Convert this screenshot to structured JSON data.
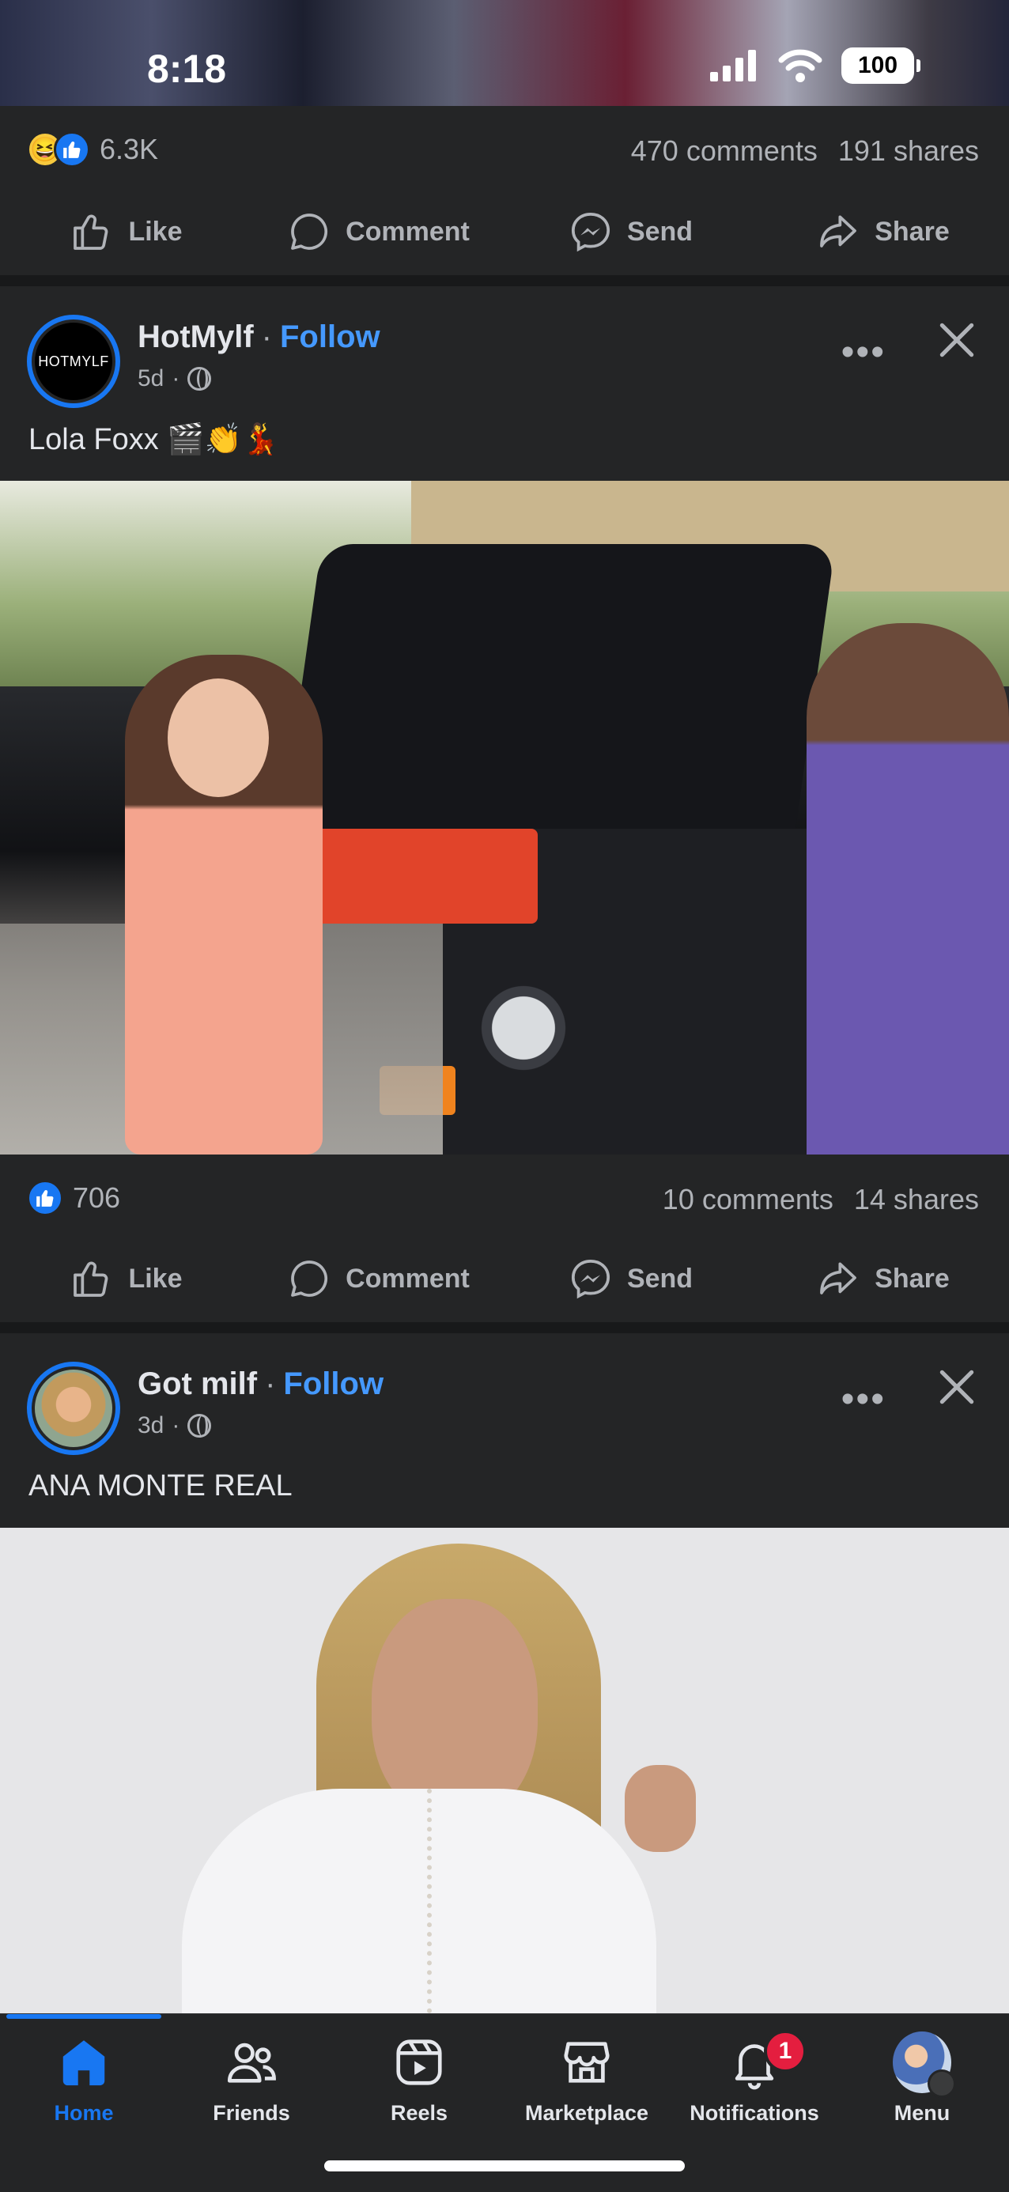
{
  "status_bar": {
    "time": "8:18",
    "battery": "100"
  },
  "prev_post": {
    "reaction_count": "6.3K",
    "comments": "470 comments",
    "shares": "191 shares"
  },
  "actions": {
    "like": "Like",
    "comment": "Comment",
    "send": "Send",
    "share": "Share"
  },
  "posts": [
    {
      "author": "HotMylf",
      "avatar_text": "HOTMYLF",
      "follow": "Follow",
      "time": "5d",
      "caption": "Lola Foxx 🎬👏💃",
      "reaction_count": "706",
      "comments": "10 comments",
      "shares": "14 shares"
    },
    {
      "author": "Got milf",
      "follow": "Follow",
      "time": "3d",
      "caption": "ANA MONTE REAL"
    }
  ],
  "nav": {
    "home": "Home",
    "friends": "Friends",
    "reels": "Reels",
    "marketplace": "Marketplace",
    "notifications": "Notifications",
    "notifications_badge": "1",
    "menu": "Menu"
  },
  "colors": {
    "accent": "#1877f2",
    "follow": "#4599ff",
    "badge": "#e41e3f",
    "background": "#242526"
  }
}
